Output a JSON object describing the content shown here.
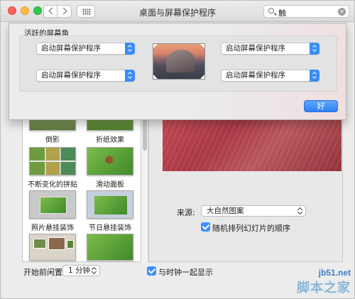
{
  "window": {
    "title": "桌面与屏幕保护程序"
  },
  "search": {
    "value": "触"
  },
  "screensaver": {
    "items": [
      {
        "label": "倒影"
      },
      {
        "label": "折纸效果"
      },
      {
        "label": "不断变化的拼贴"
      },
      {
        "label": "滑动面板"
      },
      {
        "label": "照片悬挂装饰"
      },
      {
        "label": "节日悬挂装饰"
      }
    ]
  },
  "source": {
    "label": "来源:",
    "value": "大自然图案"
  },
  "shuffle": {
    "label": "随机排列幻灯片的顺序",
    "checked": true
  },
  "bottom": {
    "idle_label": "开始前闲置:",
    "idle_value": "1 分钟",
    "clock_label": "与时钟一起显示",
    "clock_checked": true
  },
  "hot_corners": {
    "title": "活跃的屏幕角",
    "top_left": "启动屏幕保护程序",
    "top_right": "启动屏幕保护程序",
    "bottom_left": "启动屏幕保护程序",
    "bottom_right": "启动屏幕保护程序",
    "ok_label": "好"
  },
  "watermark": {
    "line1": "jb51.net",
    "line2": "脚本之家"
  },
  "colors": {
    "accent": "#3a8cf6"
  }
}
